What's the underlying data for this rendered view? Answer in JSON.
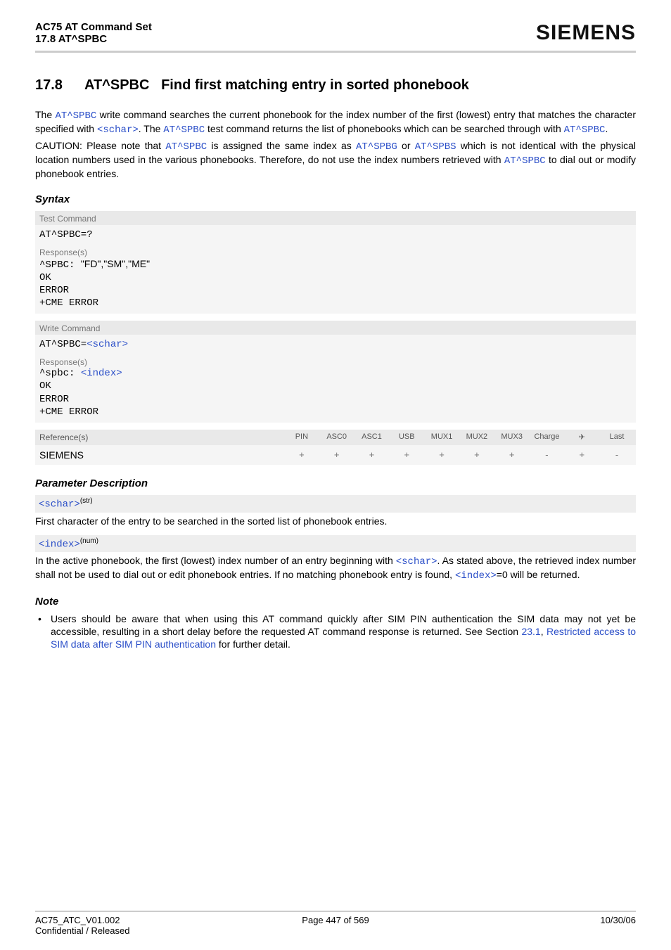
{
  "header": {
    "line1": "AC75 AT Command Set",
    "line2": "17.8 AT^SPBC",
    "brand": "SIEMENS"
  },
  "section": {
    "number": "17.8",
    "cmd": "AT^SPBC",
    "rest": "Find first matching entry in sorted phonebook"
  },
  "intro": {
    "p1a": "The ",
    "p1b": "AT^SPBC",
    "p1c": " write command searches the current phonebook for the index number of the first (lowest) entry that matches the character specified with ",
    "p1d": "<schar>",
    "p1e": ". The ",
    "p1f": "AT^SPBC",
    "p1g": " test command returns the list of phonebooks which can be searched through with ",
    "p1h": "AT^SPBC",
    "p1i": ".",
    "p2a": "CAUTION: Please note that ",
    "p2b": "AT^SPBC",
    "p2c": " is assigned the same index as ",
    "p2d": "AT^SPBG",
    "p2e": " or ",
    "p2f": "AT^SPBS",
    "p2g": " which is not identical with the physical location numbers used in the various phonebooks. Therefore, do not use the index numbers retrieved with ",
    "p2h": "AT^SPBC",
    "p2i": " to dial out or modify phonebook entries."
  },
  "syntax": {
    "heading": "Syntax",
    "test_lbl": "Test Command",
    "test_cmd": "AT^SPBC=?",
    "resp_lbl": "Response(s)",
    "test_resp_l1a": "^SPBC: ",
    "test_resp_l1b": "\"FD\",\"SM\",\"ME\"",
    "test_resp_l2": "OK",
    "test_resp_l3": "ERROR",
    "test_resp_l4": "+CME ERROR",
    "write_lbl": "Write Command",
    "write_cmd_a": "AT^SPBC=",
    "write_cmd_b": "<schar>",
    "write_resp_l1a": "^spbc: ",
    "write_resp_l1b": "<index>",
    "write_resp_l2": "OK",
    "write_resp_l3": "ERROR",
    "write_resp_l4": "+CME ERROR",
    "ref_lbl": "Reference(s)",
    "ref_val": "SIEMENS",
    "cols": [
      "PIN",
      "ASC0",
      "ASC1",
      "USB",
      "MUX1",
      "MUX2",
      "MUX3",
      "Charge",
      "✈",
      "Last"
    ],
    "vals": [
      "+",
      "+",
      "+",
      "+",
      "+",
      "+",
      "+",
      "-",
      "+",
      "-"
    ]
  },
  "params": {
    "heading": "Parameter Description",
    "p1_name": "<schar>",
    "p1_type": "(str)",
    "p1_desc": "First character of the entry to be searched in the sorted list of phonebook entries.",
    "p2_name": "<index>",
    "p2_type": "(num)",
    "p2a": "In the active phonebook, the first (lowest) index number of an entry beginning with ",
    "p2b": "<schar>",
    "p2c": ". As stated above, the retrieved index number shall not be used to dial out or edit phonebook entries. If no matching phonebook entry is found, ",
    "p2d": "<index>",
    "p2e": "=0 will be returned."
  },
  "note": {
    "heading": "Note",
    "n1a": "Users should be aware that when using this AT command quickly after SIM PIN authentication the SIM data may not yet be accessible, resulting in a short delay before the requested AT command response is returned. See Section ",
    "n1b": "23.1",
    "n1c": ", ",
    "n1d": "Restricted access to SIM data after SIM PIN authentication",
    "n1e": " for further detail."
  },
  "footer": {
    "l1": "AC75_ATC_V01.002",
    "l2": "Confidential / Released",
    "center": "Page 447 of 569",
    "right": "10/30/06"
  }
}
